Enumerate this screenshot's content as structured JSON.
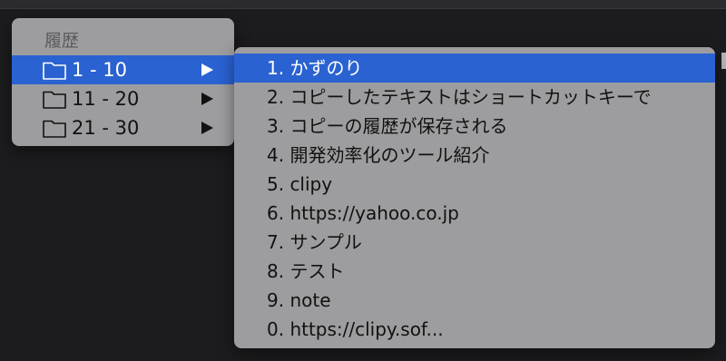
{
  "menu": {
    "header": "履歴",
    "folders": [
      {
        "label": "1 - 10"
      },
      {
        "label": "11 - 20"
      },
      {
        "label": "21 - 30"
      }
    ]
  },
  "submenu": {
    "items": [
      {
        "label": "1. かずのり"
      },
      {
        "label": "2. コピーしたテキストはショートカットキーで"
      },
      {
        "label": "3. コピーの履歴が保存される"
      },
      {
        "label": "4. 開発効率化のツール紹介"
      },
      {
        "label": "5. clipy"
      },
      {
        "label": "6. https://yahoo.co.jp"
      },
      {
        "label": "7. サンプル"
      },
      {
        "label": "8. テスト"
      },
      {
        "label": "9. note"
      },
      {
        "label": "0. https://clipy.sof..."
      }
    ]
  },
  "icons": {
    "folder": "folder-icon",
    "submenu_arrow": "arrow-right-icon"
  },
  "colors": {
    "menu_background": "#9d9d9f",
    "selection": "#2a62d1",
    "desktop": "#1c1c1e"
  }
}
